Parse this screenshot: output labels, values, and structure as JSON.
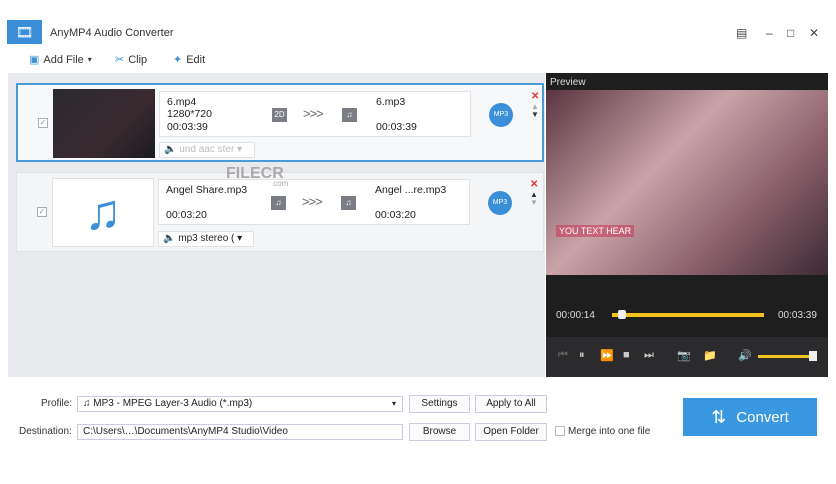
{
  "app": {
    "title": "AnyMP4 Audio Converter"
  },
  "toolbar": {
    "add_file": "Add File",
    "clip": "Clip",
    "edit": "Edit"
  },
  "files": [
    {
      "source_name": "6.mp4",
      "resolution": "1280*720",
      "source_duration": "00:03:39",
      "source_badge": "2D",
      "output_name": "6.mp3",
      "output_duration": "00:03:39",
      "audio_track": "und aac ster",
      "selected": true
    },
    {
      "source_name": "Angel Share.mp3",
      "source_duration": "00:03:20",
      "output_name": "Angel ...re.mp3",
      "output_duration": "00:03:20",
      "audio_track": "mp3 stereo (",
      "selected": false
    }
  ],
  "watermark": {
    "text": "FILECR",
    ".com": ".com"
  },
  "preview": {
    "label": "Preview",
    "overlay_text": "YOU TEXT HEAR",
    "current_time": "00:00:14",
    "total_time": "00:03:39",
    "progress": 0.064,
    "volume": 0.95
  },
  "bottom": {
    "profile_label": "Profile:",
    "profile_value": "MP3 - MPEG Layer-3 Audio (*.mp3)",
    "settings": "Settings",
    "apply_all": "Apply to All",
    "destination_label": "Destination:",
    "destination_value": "C:\\Users\\…\\Documents\\AnyMP4 Studio\\Video",
    "browse": "Browse",
    "open_folder": "Open Folder",
    "merge": "Merge into one file",
    "convert": "Convert"
  },
  "colors": {
    "accent": "#3a98e0",
    "progress": "#f2c21d"
  }
}
